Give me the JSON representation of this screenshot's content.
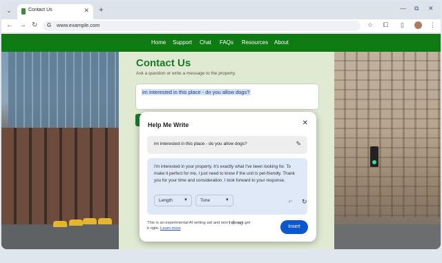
{
  "browser": {
    "tab_title": "Contact Us",
    "url": "www.example.com",
    "icons": [
      "tab-search-icon",
      "close-icon",
      "new-tab-icon",
      "minimize-icon",
      "restore-icon",
      "close-window-icon",
      "back-icon",
      "forward-icon",
      "reload-icon",
      "google-icon",
      "star-icon",
      "extensions-icon",
      "sidepanel-icon",
      "menu-icon"
    ]
  },
  "nav": {
    "links": [
      "Home",
      "Support",
      "Chat",
      "FAQs",
      "Resources",
      "About"
    ]
  },
  "contact": {
    "title": "Contact Us",
    "subtitle": "Ask a question or write a message to the property.",
    "message": "im interested in this place - do you allow dogs?"
  },
  "dialog": {
    "title": "Help Me Write",
    "prompt": "im interested in this place - do you allow dogs?",
    "draft": "I'm interested in your property. It's exactly what I've been looking for. To make it perfect for me, I just need to know if the unit is pet-friendly. Thank you for your time and consideration. I look forward to your response.",
    "length_label": "Length",
    "tone_label": "Tone",
    "disclaimer": "This is an experimental AI writing aid and won't always get it right.",
    "learn_more": "Learn more",
    "insert_label": "Insert"
  },
  "colors": {
    "brand_green": "#0e7a12",
    "title_green": "#177a24",
    "insert_blue": "#0b57d0"
  }
}
